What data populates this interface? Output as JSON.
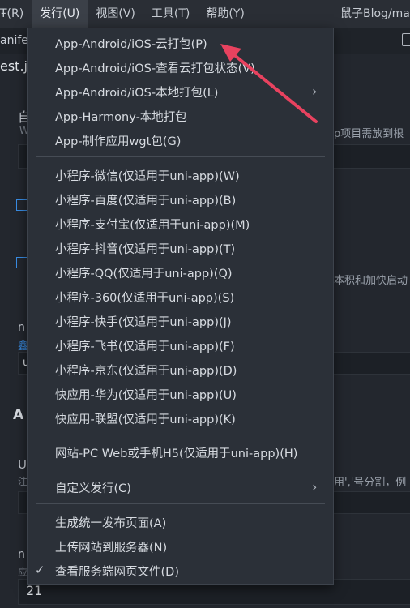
{
  "menubar": {
    "items": [
      {
        "label": "Ŧ(R)"
      },
      {
        "label": "发行(U)"
      },
      {
        "label": "视图(V)"
      },
      {
        "label": "工具(T)"
      },
      {
        "label": "帮助(Y)"
      }
    ],
    "window_title": "鼠子Blog/ma"
  },
  "tabs": {
    "first": "anifes"
  },
  "editor_bg": {
    "file_title": "est.js",
    "section1_label": "自",
    "section1_hint": "W",
    "right_hint1": "p项目需放到根",
    "right_hint2": "本积和加快启动",
    "n_label": "n",
    "link_text": "鑫",
    "input_text": "u",
    "section_a": "A",
    "u_label": "U",
    "note": "注",
    "right_hint3": "用','号分割，例",
    "n2_label": "n",
    "version_hint": "应",
    "version_value": "21"
  },
  "menu": {
    "items": [
      {
        "label": "App-Android/iOS-云打包(P)"
      },
      {
        "label": "App-Android/iOS-查看云打包状态(V)"
      },
      {
        "label": "App-Android/iOS-本地打包(L)",
        "submenu": true
      },
      {
        "label": "App-Harmony-本地打包"
      },
      {
        "label": "App-制作应用wgt包(G)"
      },
      {
        "label": "小程序-微信(仅适用于uni-app)(W)"
      },
      {
        "label": "小程序-百度(仅适用于uni-app)(B)"
      },
      {
        "label": "小程序-支付宝(仅适用于uni-app)(M)"
      },
      {
        "label": "小程序-抖音(仅适用于uni-app)(T)"
      },
      {
        "label": "小程序-QQ(仅适用于uni-app)(Q)"
      },
      {
        "label": "小程序-360(仅适用于uni-app)(S)"
      },
      {
        "label": "小程序-快手(仅适用于uni-app)(J)"
      },
      {
        "label": "小程序-飞书(仅适用于uni-app)(F)"
      },
      {
        "label": "小程序-京东(仅适用于uni-app)(D)"
      },
      {
        "label": "快应用-华为(仅适用于uni-app)(U)"
      },
      {
        "label": "快应用-联盟(仅适用于uni-app)(K)"
      },
      {
        "label": "网站-PC Web或手机H5(仅适用于uni-app)(H)"
      },
      {
        "label": "自定义发行(C)",
        "submenu": true
      },
      {
        "label": "生成统一发布页面(A)"
      },
      {
        "label": "上传网站到服务器(N)"
      },
      {
        "label": "查看服务端网页文件(D)",
        "checked": true
      }
    ]
  },
  "colors": {
    "accent_arrow": "#e8425f",
    "menu_bg": "#2b3038",
    "app_bg": "#23272e",
    "link": "#3a8ee6"
  },
  "icons": {
    "submenu": "chevron-right-icon",
    "checked": "checkmark-icon"
  }
}
